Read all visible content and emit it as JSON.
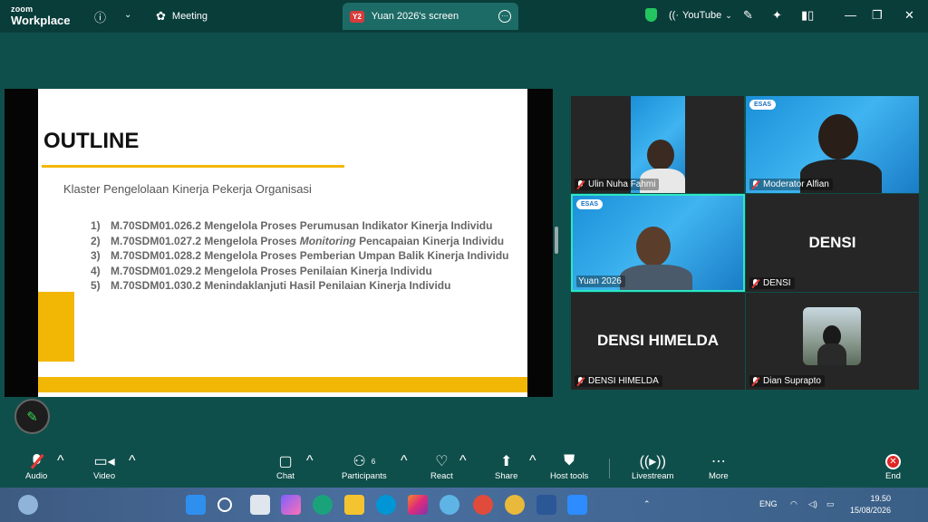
{
  "app": {
    "brand_small": "zoom",
    "brand_large": "Workplace"
  },
  "titlebar": {
    "meeting_label": "Meeting",
    "screen_tab_badge": "Y2",
    "screen_tab_label": "Yuan 2026's screen",
    "youtube_label": "YouTube"
  },
  "slide": {
    "title": "OUTLINE",
    "subtitle": "Klaster Pengelolaan Kinerja Pekerja Organisasi",
    "items": [
      {
        "num": "1)",
        "pre": "M.70SDM01.026.2 Mengelola Proses Perumusan Indikator Kinerja Individu",
        "em": "",
        "post": ""
      },
      {
        "num": "2)",
        "pre": "M.70SDM01.027.2 Mengelola Proses ",
        "em": "Monitoring",
        "post": " Pencapaian Kinerja Individu"
      },
      {
        "num": "3)",
        "pre": "M.70SDM01.028.2 Mengelola Proses Pemberian Umpan Balik Kinerja Individu",
        "em": "",
        "post": ""
      },
      {
        "num": "4)",
        "pre": "M.70SDM01.029.2 Mengelola Proses Penilaian Kinerja Individu",
        "em": "",
        "post": ""
      },
      {
        "num": "5)",
        "pre": "M.70SDM01.030.2 Menindaklanjuti Hasil Penilaian Kinerja Individu",
        "em": "",
        "post": ""
      }
    ]
  },
  "participants": {
    "ulin": {
      "name": "Ulin Nuha Fahmi"
    },
    "moderator": {
      "name": "Moderator Alfian",
      "logo": "ESAS"
    },
    "yuan": {
      "name": "Yuan 2026",
      "logo": "ESAS"
    },
    "densi": {
      "name": "DENSI",
      "big": "DENSI"
    },
    "himelda": {
      "name": "DENSI HIMELDA",
      "big": "DENSI HIMELDA"
    },
    "dian": {
      "name": "Dian Suprapto"
    }
  },
  "toolbar": {
    "audio": "Audio",
    "video": "Video",
    "chat": "Chat",
    "participants": "Participants",
    "participants_count": "6",
    "react": "React",
    "share": "Share",
    "host_tools": "Host tools",
    "livestream": "Livestream",
    "more": "More",
    "end": "End"
  },
  "taskbar": {
    "lang": "ENG",
    "time": "19.50",
    "date": "15/08/2026"
  },
  "colors": {
    "accent": "#2ee6c3",
    "slide_yellow": "#f2b705",
    "end_red": "#e02424"
  }
}
